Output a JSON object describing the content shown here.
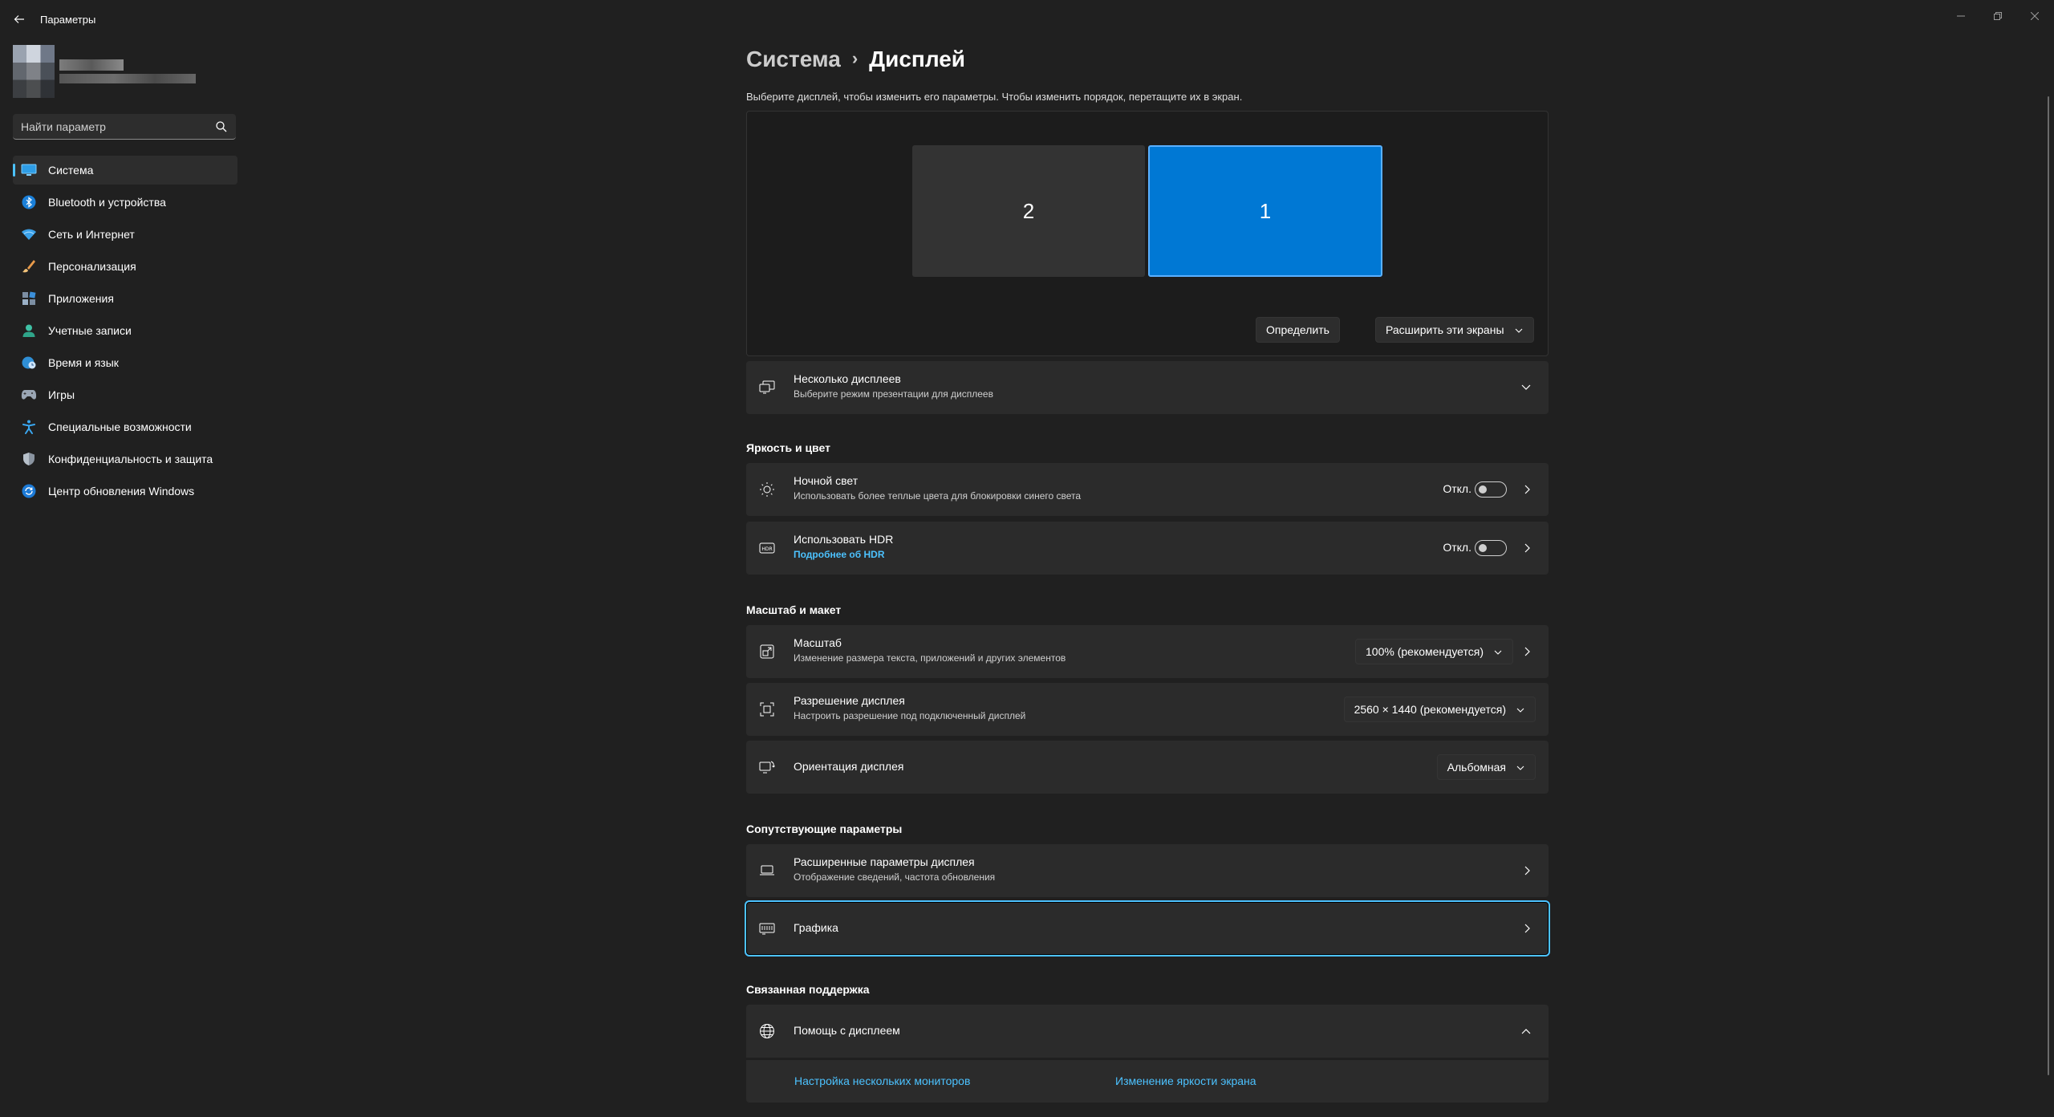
{
  "app": {
    "title": "Параметры"
  },
  "search": {
    "placeholder": "Найти параметр"
  },
  "sidebar": {
    "items": [
      {
        "label": "Система",
        "icon": "monitor-icon",
        "active": true
      },
      {
        "label": "Bluetooth и устройства",
        "icon": "bluetooth-icon"
      },
      {
        "label": "Сеть и Интернет",
        "icon": "wifi-icon"
      },
      {
        "label": "Персонализация",
        "icon": "brush-icon"
      },
      {
        "label": "Приложения",
        "icon": "apps-icon"
      },
      {
        "label": "Учетные записи",
        "icon": "account-icon"
      },
      {
        "label": "Время и язык",
        "icon": "globe-clock-icon"
      },
      {
        "label": "Игры",
        "icon": "gamepad-icon"
      },
      {
        "label": "Специальные возможности",
        "icon": "accessibility-icon"
      },
      {
        "label": "Конфиденциальность и защита",
        "icon": "shield-icon"
      },
      {
        "label": "Центр обновления Windows",
        "icon": "update-icon"
      }
    ]
  },
  "breadcrumb": {
    "parent": "Система",
    "separator": "›",
    "current": "Дисплей"
  },
  "instructions": "Выберите дисплей, чтобы изменить его параметры. Чтобы изменить порядок, перетащите их в экран.",
  "displays": {
    "monitors": [
      {
        "label": "2",
        "selected": false
      },
      {
        "label": "1",
        "selected": true
      }
    ],
    "identify_button": "Определить",
    "mode_dropdown": "Расширить эти экраны"
  },
  "multiple_displays": {
    "title": "Несколько дисплеев",
    "subtitle": "Выберите режим презентации для дисплеев"
  },
  "brightness_section": {
    "title": "Яркость и цвет",
    "night_light": {
      "title": "Ночной свет",
      "subtitle": "Использовать более теплые цвета для блокировки синего света",
      "state": "Откл."
    },
    "hdr": {
      "title": "Использовать HDR",
      "link": "Подробнее об HDR",
      "state": "Откл."
    }
  },
  "scale_section": {
    "title": "Масштаб и макет",
    "scale": {
      "title": "Масштаб",
      "subtitle": "Изменение размера текста, приложений и других элементов",
      "value": "100% (рекомендуется)"
    },
    "resolution": {
      "title": "Разрешение дисплея",
      "subtitle": "Настроить разрешение под подключенный дисплей",
      "value": "2560 × 1440 (рекомендуется)"
    },
    "orientation": {
      "title": "Ориентация дисплея",
      "value": "Альбомная"
    }
  },
  "related_section": {
    "title": "Сопутствующие параметры",
    "advanced": {
      "title": "Расширенные параметры дисплея",
      "subtitle": "Отображение сведений, частота обновления"
    },
    "graphics": {
      "title": "Графика"
    }
  },
  "support_section": {
    "title": "Связанная поддержка",
    "help": {
      "title": "Помощь с дисплеем"
    },
    "links": [
      "Настройка нескольких мониторов",
      "Изменение яркости экрана"
    ]
  },
  "colors": {
    "accent": "#4cc2ff",
    "selected_monitor": "#0078d4",
    "background": "#202020",
    "card": "#2b2b2b"
  }
}
